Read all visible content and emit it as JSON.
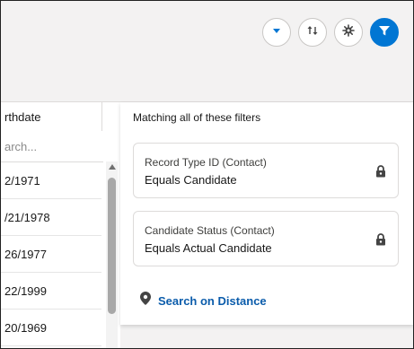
{
  "toolbar": {
    "buttons": [
      {
        "icon": "chevron-down-icon"
      },
      {
        "icon": "sort-arrows-icon"
      },
      {
        "icon": "settings-gear-icon"
      },
      {
        "icon": "filter-funnel-icon",
        "active": true
      }
    ],
    "accent_color": "#0176d3"
  },
  "list": {
    "column_header": "rthdate",
    "search_placeholder": "arch...",
    "rows": [
      "2/1971",
      "/21/1978",
      "26/1977",
      "22/1999",
      "20/1969"
    ]
  },
  "filter_panel": {
    "title": "Matching all of these filters",
    "filters": [
      {
        "field": "Record Type ID (Contact)",
        "value": "Equals Candidate",
        "locked": true
      },
      {
        "field": "Candidate Status (Contact)",
        "value": "Equals Actual Candidate",
        "locked": true
      }
    ],
    "distance_link": "Search on Distance",
    "link_color": "#0b5cab"
  }
}
